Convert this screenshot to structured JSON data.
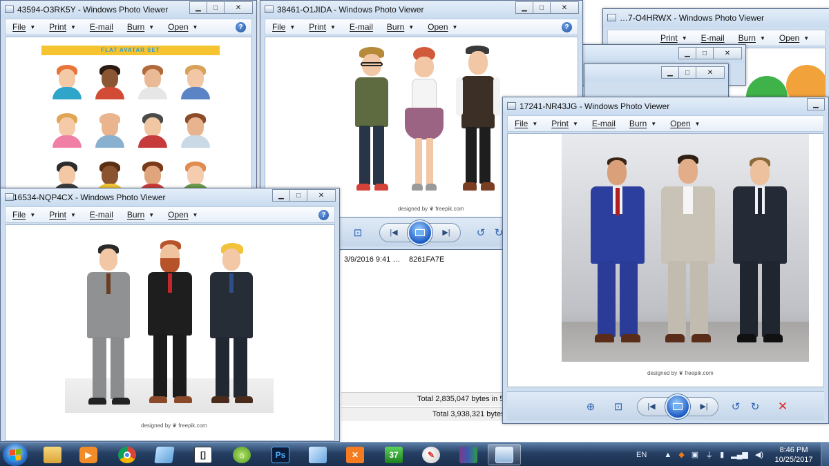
{
  "menu": {
    "file": "File",
    "print": "Print",
    "email": "E-mail",
    "burn": "Burn",
    "open": "Open"
  },
  "windows": {
    "w1": {
      "title": "43594-O3RK5Y - Windows Photo Viewer",
      "banner": "FLAT AVATAR SET"
    },
    "w2": {
      "title": "38461-O1JIDA - Windows Photo Viewer",
      "credit": "designed by ❦ freepik.com"
    },
    "w3": {
      "title": "16534-NQP4CX - Windows Photo Viewer",
      "credit": "designed by ❦ freepik.com"
    },
    "w4": {
      "title": "17241-NR43JG - Windows Photo Viewer",
      "credit": "designed by ❦ freepik.com"
    },
    "bg1": {
      "title": "…7-O4HRWX - Windows Photo Viewer"
    }
  },
  "explorer": {
    "date": "3/9/2016 9:41 …",
    "hash": "8261FA7E",
    "total1": "Total 2,835,047 bytes in 5 fi…",
    "total2": "Total 3,938,321 bytes …"
  },
  "taskbar": {
    "lang": "EN",
    "time": "8:46 PM",
    "date": "10/25/2017",
    "apps": [
      "file-explorer",
      "media-player",
      "chrome",
      "notepad",
      "tray-app",
      "green-app",
      "photoshop",
      "box-app",
      "xampp",
      "media-center",
      "paint",
      "winrar",
      "photo-viewer"
    ]
  },
  "colors": {
    "accent": "#2a5eb2",
    "titlebar": "#cfdff0",
    "taskbar": "#253f63"
  }
}
